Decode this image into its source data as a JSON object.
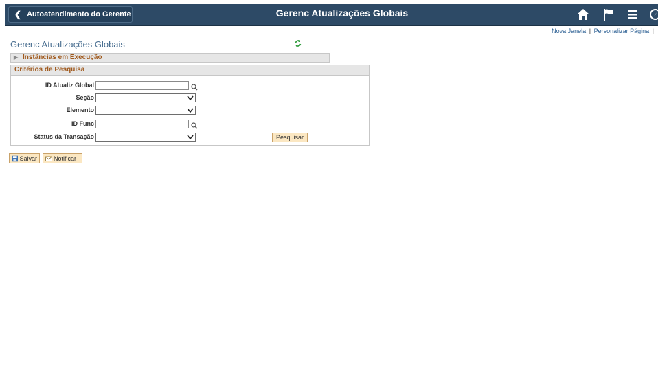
{
  "header": {
    "back_label": "Autoatendimento do Gerente",
    "title": "Gerenc Atualizações Globais",
    "icons": [
      "home-icon",
      "flag-icon",
      "menu-icon",
      "navbar-icon"
    ]
  },
  "top_links": {
    "new_window": "Nova Janela",
    "personalize": "Personalizar Página",
    "separator": "|"
  },
  "page": {
    "title": "Gerenc Atualizações Globais"
  },
  "instances_section": {
    "label": "Instâncias em Execução"
  },
  "search": {
    "header": "Critérios de Pesquisa",
    "fields": [
      {
        "label": "ID Atualiz Global",
        "value": ""
      },
      {
        "label": "Seção",
        "value": ""
      },
      {
        "label": "Elemento",
        "value": ""
      },
      {
        "label": "ID Func",
        "value": ""
      },
      {
        "label": "Status da Transação",
        "value": ""
      }
    ],
    "search_button": "Pesquisar"
  },
  "toolbar": {
    "save_label": "Salvar",
    "notify_label": "Notificar"
  },
  "colors": {
    "header_bg": "#2d4a66",
    "section_text": "#a05a1e",
    "button_bg": "#fbe7c2",
    "title_text": "#4a6f91"
  }
}
